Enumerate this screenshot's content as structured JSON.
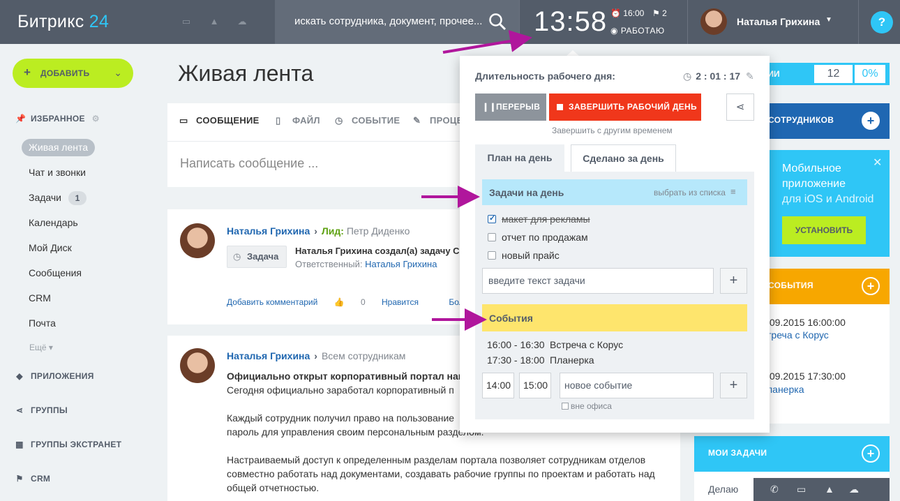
{
  "header": {
    "logo_text": "Битрикс",
    "logo_num": "24",
    "search_placeholder": "искать сотрудника, документ, прочее...",
    "clock_time": "13:58",
    "alarm_time": "16:00",
    "flag_count": "2",
    "work_status": "РАБОТАЮ",
    "user_name": "Наталья Грихина",
    "help_label": "?"
  },
  "sidebar": {
    "add_label": "ДОБАВИТЬ",
    "favorites_label": "ИЗБРАННОЕ",
    "items": [
      {
        "label": "Живая лента"
      },
      {
        "label": "Чат и звонки"
      },
      {
        "label": "Задачи",
        "badge": "1"
      },
      {
        "label": "Календарь"
      },
      {
        "label": "Мой Диск"
      },
      {
        "label": "Сообщения"
      },
      {
        "label": "CRM"
      },
      {
        "label": "Почта"
      }
    ],
    "more_label": "Ещё",
    "groups": [
      {
        "label": "ПРИЛОЖЕНИЯ"
      },
      {
        "label": "ГРУППЫ"
      },
      {
        "label": "ГРУППЫ ЭКСТРАНЕТ"
      },
      {
        "label": "CRM"
      }
    ]
  },
  "main": {
    "title": "Живая лента",
    "composer_tabs": [
      {
        "label": "СООБЩЕНИЕ"
      },
      {
        "label": "ФАЙЛ"
      },
      {
        "label": "СОБЫТИЕ"
      },
      {
        "label": "ПРОЦЕ"
      }
    ],
    "composer_placeholder": "Написать сообщение ...",
    "post1": {
      "author": "Наталья Грихина",
      "lead_label": "Лид:",
      "lead_name": "Петр Диденко",
      "chip": "Задача",
      "line1": "Наталья Грихина создал(а) задачу С",
      "resp_label": "Ответственный:",
      "resp_name": "Наталья Грихина",
      "comment": "Добавить комментарий",
      "likes": "0",
      "like_label": "Нравится",
      "more": "Больше не сле"
    },
    "post2": {
      "author": "Наталья Грихина",
      "dest": "Всем сотрудникам",
      "heading": "Официально открыт корпоративный портал нац",
      "p1": "Сегодня официально заработал корпоративный п",
      "p2a": "Каждый сотрудник получил право на пользование",
      "p2b": "пароль для управления своим персональным разделом.",
      "p3a": "Настраиваемый доступ к определенным разделам портала позволяет сотрудникам отделов",
      "p3b": "совместно работать над документами, создавать рабочие группы по проектам и работать над",
      "p3c": "общей отчетностью."
    }
  },
  "right": {
    "stat_label": "АНИИ",
    "stat_num": "12",
    "stat_pct": "0%",
    "employees_label": "СОТРУДНИКОВ",
    "mobile_line1": "Мобильное",
    "mobile_line2": "приложение",
    "mobile_line3": "для iOS и Android",
    "install_label": "УСТАНОВИТЬ",
    "events_label": "СОБЫТИЯ",
    "event1_date": ".09.2015 16:00:00",
    "event1_name": "треча с Корус",
    "event2_date": ".09.2015 17:30:00",
    "event2_name": "ланерка",
    "tasks_label": "МОИ ЗАДАЧИ",
    "doing_label": "Делаю"
  },
  "popup": {
    "duration_label": "Длительность рабочего дня:",
    "duration_value": "2 : 01 : 17",
    "pause_label": "ПЕРЕРЫВ",
    "finish_label": "ЗАВЕРШИТЬ РАБОЧИЙ ДЕНЬ",
    "finish_other": "Завершить с другим временем",
    "tab_plan": "План на день",
    "tab_done": "Сделано за день",
    "tasks_head": "Задачи на день",
    "pick_label": "выбрать из списка",
    "tasks": [
      {
        "label": "макет для рекламы",
        "done": true
      },
      {
        "label": "отчет по продажам",
        "done": false
      },
      {
        "label": "новый прайс",
        "done": false
      }
    ],
    "task_input_placeholder": "введите текст задачи",
    "events_head": "События",
    "events": [
      {
        "time": "16:00 - 16:30",
        "name": "Встреча с Корус"
      },
      {
        "time": "17:30 - 18:00",
        "name": "Планерка"
      }
    ],
    "ev_from": "14:00",
    "ev_to": "15:00",
    "ev_placeholder": "новое событие",
    "offsite_label": "вне офиса"
  },
  "colors": {
    "header_bg": "#535c69",
    "accent_green": "#bbed21",
    "accent_blue": "#2fc6f6",
    "finish_red": "#f0371b",
    "events_yellow": "#fee56d",
    "annotation_arrow": "#b0169c"
  }
}
